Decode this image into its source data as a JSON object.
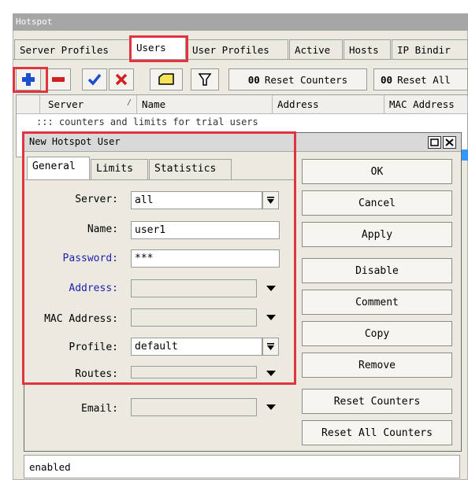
{
  "window": {
    "title": "Hotspot"
  },
  "tabs": [
    {
      "label": "Server Profiles"
    },
    {
      "label": "Users"
    },
    {
      "label": "User Profiles"
    },
    {
      "label": "Active"
    },
    {
      "label": "Hosts"
    },
    {
      "label": "IP Bindir"
    }
  ],
  "toolbar": {
    "reset_counters": {
      "mark": "00",
      "label": "Reset Counters"
    },
    "reset_all": {
      "mark": "00",
      "label": "Reset All"
    }
  },
  "list": {
    "columns": [
      "Server",
      "Name",
      "Address",
      "MAC Address"
    ],
    "sort_mark": "/",
    "comment": ";;; counters and limits for trial users"
  },
  "dialog": {
    "title": "New Hotspot User",
    "tabs": [
      {
        "label": "General"
      },
      {
        "label": "Limits"
      },
      {
        "label": "Statistics"
      }
    ],
    "fields": {
      "server": {
        "label": "Server:",
        "value": "all"
      },
      "name": {
        "label": "Name:",
        "value": "user1"
      },
      "password": {
        "label": "Password:",
        "value": "***"
      },
      "address": {
        "label": "Address:",
        "value": ""
      },
      "mac_address": {
        "label": "MAC Address:",
        "value": ""
      },
      "profile": {
        "label": "Profile:",
        "value": "default"
      },
      "routes": {
        "label": "Routes:",
        "value": ""
      },
      "email": {
        "label": "Email:",
        "value": ""
      }
    },
    "buttons": {
      "ok": "OK",
      "cancel": "Cancel",
      "apply": "Apply",
      "disable": "Disable",
      "comment": "Comment",
      "copy": "Copy",
      "remove": "Remove",
      "reset_counters": "Reset Counters",
      "reset_all_counters": "Reset All Counters"
    },
    "status": "enabled"
  },
  "colors": {
    "highlight": "#e0343f",
    "field_label_blue": "#2020b0",
    "selection": "#3399ff",
    "add_icon": "#1a4fd0",
    "remove_icon": "#d02020"
  }
}
